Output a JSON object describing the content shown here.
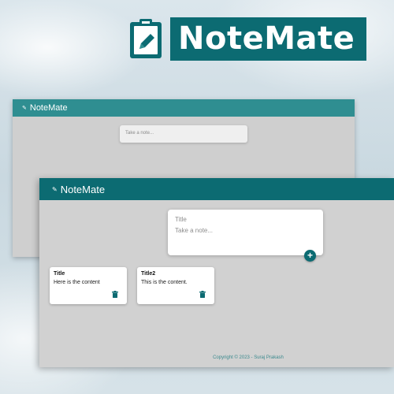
{
  "brand": {
    "name": "NoteMate",
    "hero_icon": "clipboard-pencil-icon",
    "accent": "#0c6b72",
    "header_back": "#2f8e91",
    "logo_glyph": "✎"
  },
  "back_window": {
    "header_title": "NoteMate",
    "input_placeholder": "Take a note..."
  },
  "front_window": {
    "header_title": "NoteMate",
    "compose": {
      "title_placeholder": "Title",
      "body_placeholder": "Take a note...",
      "add_label": "+"
    },
    "notes": [
      {
        "title": "Title",
        "content": "Here is the content",
        "delete_icon": "trash-icon"
      },
      {
        "title": "Title2",
        "content": "This is the content.",
        "delete_icon": "trash-icon"
      }
    ],
    "footer": "Copyright © 2023 - Suraj Prakash"
  }
}
